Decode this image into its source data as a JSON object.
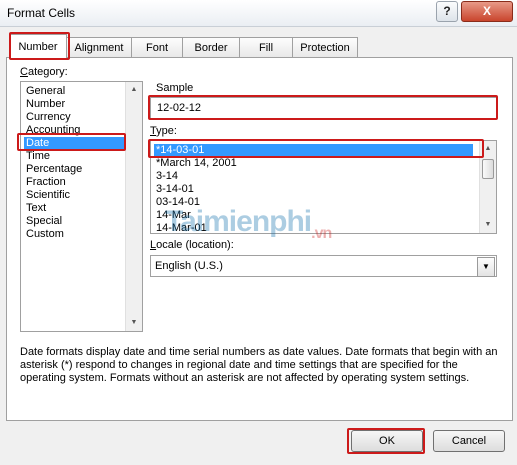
{
  "window": {
    "title": "Format Cells",
    "help_glyph": "?",
    "close_glyph": "X"
  },
  "tabs": [
    {
      "label": "Number",
      "active": true
    },
    {
      "label": "Alignment",
      "active": false
    },
    {
      "label": "Font",
      "active": false
    },
    {
      "label": "Border",
      "active": false
    },
    {
      "label": "Fill",
      "active": false
    },
    {
      "label": "Protection",
      "active": false
    }
  ],
  "category": {
    "label_underlined": "C",
    "label_rest": "ategory:",
    "items": [
      "General",
      "Number",
      "Currency",
      "Accounting",
      "Date",
      "Time",
      "Percentage",
      "Fraction",
      "Scientific",
      "Text",
      "Special",
      "Custom"
    ],
    "selected": "Date"
  },
  "sample": {
    "label": "Sample",
    "value": "12-02-12"
  },
  "type": {
    "label_underlined": "T",
    "label_rest": "ype:",
    "items": [
      "*14-03-01",
      "*March 14, 2001",
      "3-14",
      "3-14-01",
      "03-14-01",
      "14-Mar",
      "14-Mar-01"
    ],
    "selected": "*14-03-01"
  },
  "locale": {
    "label_underlined": "L",
    "label_rest": "ocale (location):",
    "value": "English (U.S.)"
  },
  "watermark": {
    "main": "Taimienphi",
    "sub": ".vn"
  },
  "description": "Date formats display date and time serial numbers as date values.  Date formats that begin with an asterisk (*) respond to changes in regional date and time settings that are specified for the operating system. Formats without an asterisk are not affected by operating system settings.",
  "buttons": {
    "ok": "OK",
    "cancel": "Cancel"
  },
  "colors": {
    "selection": "#3399ff",
    "highlight": "#cc1a1a"
  }
}
